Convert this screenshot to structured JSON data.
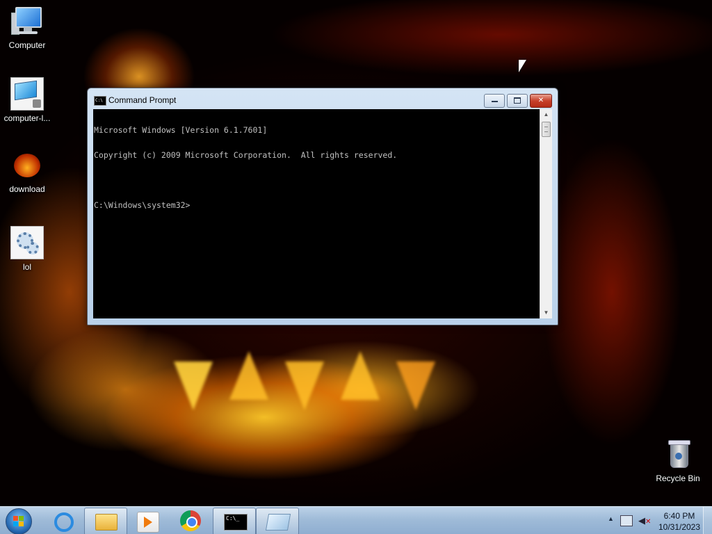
{
  "desktop": {
    "icons": [
      {
        "label": "Computer",
        "icon": "computer-icon"
      },
      {
        "label": "computer-l...",
        "icon": "remote-computer-icon"
      },
      {
        "label": "download",
        "icon": "pumpkin-image-icon"
      },
      {
        "label": "lol",
        "icon": "settings-file-icon"
      }
    ],
    "recycle_bin": {
      "label": "Recycle Bin",
      "icon": "recycle-bin-icon"
    }
  },
  "window": {
    "title": "Command Prompt",
    "buttons": {
      "minimize": "minimize",
      "maximize": "maximize",
      "close": "close"
    },
    "console_lines": [
      "Microsoft Windows [Version 6.1.7601]",
      "Copyright (c) 2009 Microsoft Corporation.  All rights reserved.",
      "",
      "C:\\Windows\\system32>"
    ]
  },
  "taskbar": {
    "start_icon": "windows-start-icon",
    "apps": [
      {
        "name": "internet-explorer-icon",
        "open": false
      },
      {
        "name": "file-explorer-icon",
        "open": true
      },
      {
        "name": "media-player-icon",
        "open": false
      },
      {
        "name": "chrome-icon",
        "open": false
      },
      {
        "name": "command-prompt-icon",
        "open": true
      },
      {
        "name": "paper-app-icon",
        "open": true
      }
    ],
    "tray": {
      "time": "6:40 PM",
      "date": "10/31/2023"
    }
  },
  "colors": {
    "console_bg": "#000000",
    "console_fg": "#c0c0c0",
    "taskbar": "#9fbbd8",
    "close_button": "#c7402a"
  }
}
